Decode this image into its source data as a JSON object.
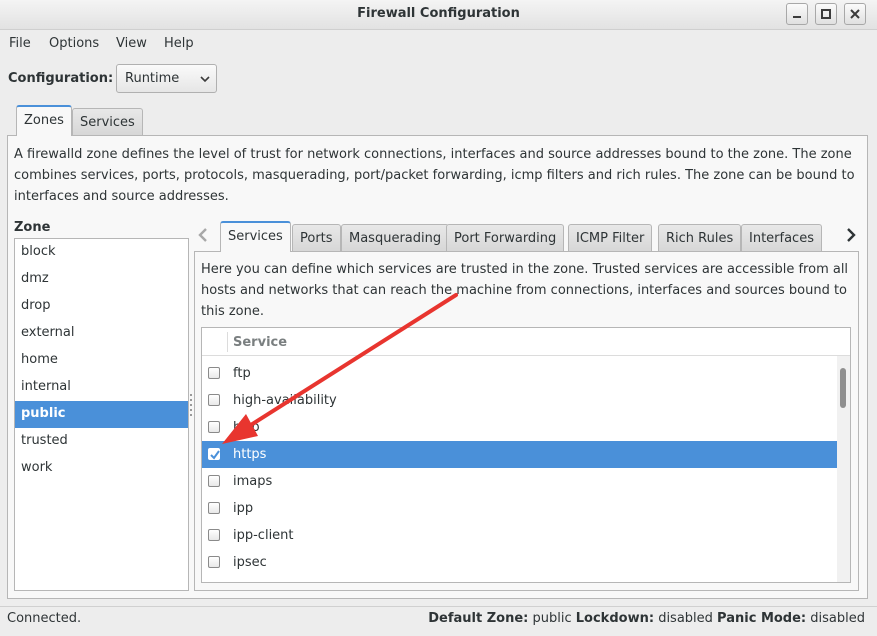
{
  "window": {
    "title": "Firewall Configuration"
  },
  "menu": [
    "File",
    "Options",
    "View",
    "Help"
  ],
  "configuration": {
    "label": "Configuration:",
    "value": "Runtime"
  },
  "top_tabs": [
    "Zones",
    "Services"
  ],
  "zones_description": "A firewalld zone defines the level of trust for network connections, interfaces and source addresses bound to the zone. The zone combines services, ports, protocols, masquerading, port/packet forwarding, icmp filters and rich rules. The zone can be bound to interfaces and source addresses.",
  "zone_panel": {
    "label": "Zone",
    "items": [
      "block",
      "dmz",
      "drop",
      "external",
      "home",
      "internal",
      "public",
      "trusted",
      "work"
    ],
    "selected": "public"
  },
  "zone_tabs": [
    "Services",
    "Ports",
    "Masquerading",
    "Port Forwarding",
    "ICMP Filter",
    "Rich Rules",
    "Interfaces"
  ],
  "services_description": "Here you can define which services are trusted in the zone. Trusted services are accessible from all hosts and networks that can reach the machine from connections, interfaces and sources bound to this zone.",
  "service_table": {
    "header": "Service",
    "rows": [
      {
        "name": "ftp",
        "checked": false
      },
      {
        "name": "high-availability",
        "checked": false
      },
      {
        "name": "http",
        "checked": false
      },
      {
        "name": "https",
        "checked": true
      },
      {
        "name": "imaps",
        "checked": false
      },
      {
        "name": "ipp",
        "checked": false
      },
      {
        "name": "ipp-client",
        "checked": false
      },
      {
        "name": "ipsec",
        "checked": false
      }
    ],
    "selected": "https"
  },
  "status": {
    "connection": "Connected.",
    "default_zone_label": "Default Zone:",
    "default_zone": "public",
    "lockdown_label": "Lockdown:",
    "lockdown": "disabled",
    "panic_label": "Panic Mode:",
    "panic": "disabled"
  },
  "colors": {
    "selection": "#4a90d9",
    "annotation_arrow": "#e8352f"
  }
}
